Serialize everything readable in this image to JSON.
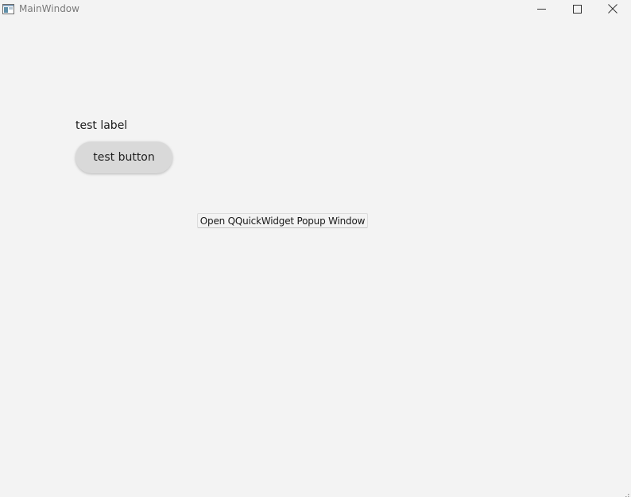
{
  "window": {
    "title": "MainWindow",
    "icon": "app-window-icon",
    "controls": {
      "minimize_icon": "minimize-icon",
      "maximize_icon": "maximize-icon",
      "close_icon": "close-icon"
    }
  },
  "main": {
    "label_text": "test label",
    "button_text": "test button",
    "popup_button_text": "Open QQuickWidget Popup Window"
  },
  "colors": {
    "background": "#f3f3f3",
    "button_fill": "#d9d9d9",
    "title_text": "#7a7a7a"
  }
}
